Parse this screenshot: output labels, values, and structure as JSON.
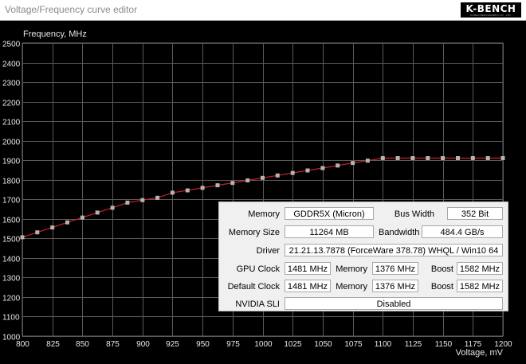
{
  "window": {
    "title": "Voltage/Frequency curve editor"
  },
  "logo": {
    "brand": "K-BENCH",
    "tagline": "KOREA BENCHMARKS CO., LTD."
  },
  "chart_data": {
    "type": "line",
    "ylabel": "Frequency, MHz",
    "xlabel": "Voltage, mV",
    "xlim": [
      800,
      1200
    ],
    "ylim": [
      1000,
      2500
    ],
    "x_ticks": [
      800,
      825,
      850,
      875,
      900,
      925,
      950,
      975,
      1000,
      1025,
      1050,
      1075,
      1100,
      1125,
      1150,
      1175,
      1200
    ],
    "y_ticks": [
      1000,
      1100,
      1200,
      1300,
      1400,
      1500,
      1600,
      1700,
      1800,
      1900,
      2000,
      2100,
      2200,
      2300,
      2400,
      2500
    ],
    "grid": true,
    "series": [
      {
        "color": "#cc2222",
        "x": [
          800,
          812.5,
          825,
          837.5,
          850,
          862.5,
          875,
          887.5,
          900,
          912.5,
          925,
          937.5,
          950,
          962.5,
          975,
          987.5,
          1000,
          1012.5,
          1025,
          1037.5,
          1050,
          1062.5,
          1075,
          1087.5,
          1100,
          1112.5,
          1125,
          1137.5,
          1150,
          1162.5,
          1175,
          1187.5,
          1200
        ],
        "y": [
          1506,
          1531,
          1556,
          1582,
          1607,
          1632,
          1657,
          1683,
          1696,
          1708,
          1734,
          1746,
          1759,
          1772,
          1784,
          1797,
          1810,
          1822,
          1835,
          1848,
          1860,
          1873,
          1886,
          1898,
          1911,
          1911,
          1911,
          1911,
          1911,
          1911,
          1911,
          1911,
          1911
        ]
      }
    ]
  },
  "info": {
    "memory_label": "Memory",
    "memory_value": "GDDR5X (Micron)",
    "bus_width_label": "Bus Width",
    "bus_width_value": "352 Bit",
    "memory_size_label": "Memory Size",
    "memory_size_value": "11264 MB",
    "bandwidth_label": "Bandwidth",
    "bandwidth_value": "484.4 GB/s",
    "driver_label": "Driver",
    "driver_value": "21.21.13.7878 (ForceWare 378.78) WHQL / Win10 64",
    "gpu_clock_label": "GPU Clock",
    "gpu_clock_value": "1481 MHz",
    "gpu_memory_label": "Memory",
    "gpu_memory_value": "1376 MHz",
    "gpu_boost_label": "Boost",
    "gpu_boost_value": "1582 MHz",
    "default_clock_label": "Default Clock",
    "default_clock_value": "1481 MHz",
    "default_memory_label": "Memory",
    "default_memory_value": "1376 MHz",
    "default_boost_label": "Boost",
    "default_boost_value": "1582 MHz",
    "sli_label": "NVIDIA SLI",
    "sli_value": "Disabled"
  }
}
